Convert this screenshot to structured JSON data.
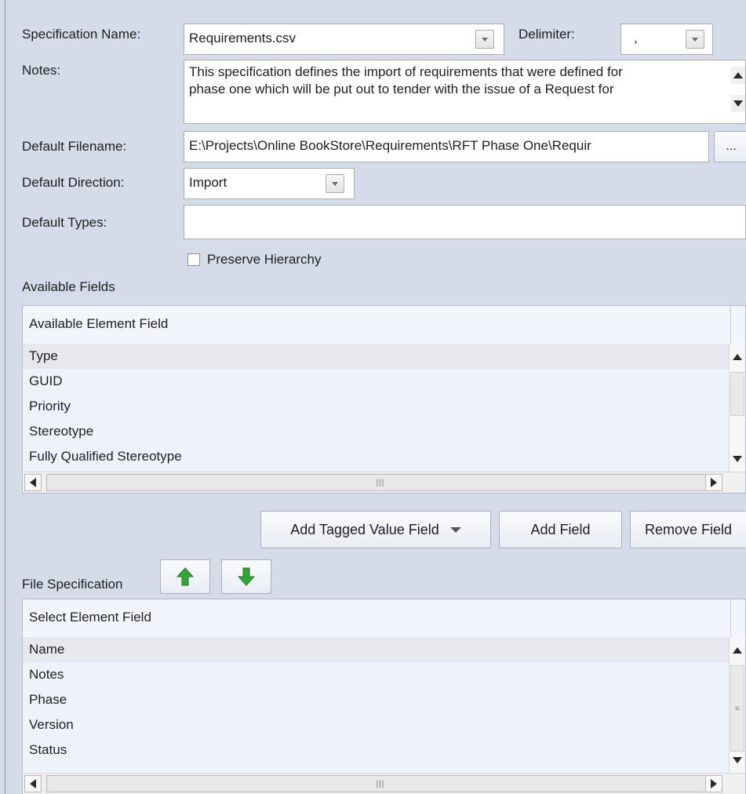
{
  "form": {
    "spec_name_label": "Specification Name:",
    "spec_name_value": "Requirements.csv",
    "delimiter_label": "Delimiter:",
    "delimiter_value": ",",
    "notes_label": "Notes:",
    "notes_lines": [
      "This specification defines the import of requirements that were defined for",
      "phase one which will be put out to tender with the issue of a Request for"
    ],
    "default_filename_label": "Default Filename:",
    "default_filename_value": "E:\\Projects\\Online BookStore\\Requirements\\RFT Phase One\\Requir",
    "browse_label": "...",
    "default_direction_label": "Default Direction:",
    "default_direction_value": "Import",
    "default_types_label": "Default Types:",
    "default_types_value": "",
    "preserve_hierarchy_label": "Preserve Hierarchy",
    "preserve_hierarchy_checked": false
  },
  "available_fields": {
    "section_label": "Available Fields",
    "column_header": "Available Element Field",
    "rows": [
      "Type",
      "GUID",
      "Priority",
      "Stereotype",
      "Fully Qualified Stereotype"
    ],
    "selected_index": 0
  },
  "buttons": {
    "add_tagged_value_field": "Add Tagged Value Field",
    "add_field": "Add Field",
    "remove_field": "Remove Field"
  },
  "file_specification": {
    "section_label": "File Specification",
    "column_header": "Select Element Field",
    "rows": [
      "Name",
      "Notes",
      "Phase",
      "Version",
      "Status"
    ],
    "selected_index": 0
  },
  "colors": {
    "background": "#d6dbe9",
    "arrow_green": "#2fa836"
  },
  "icons": {
    "move_up": "up-arrow-icon",
    "move_down": "down-arrow-icon"
  }
}
